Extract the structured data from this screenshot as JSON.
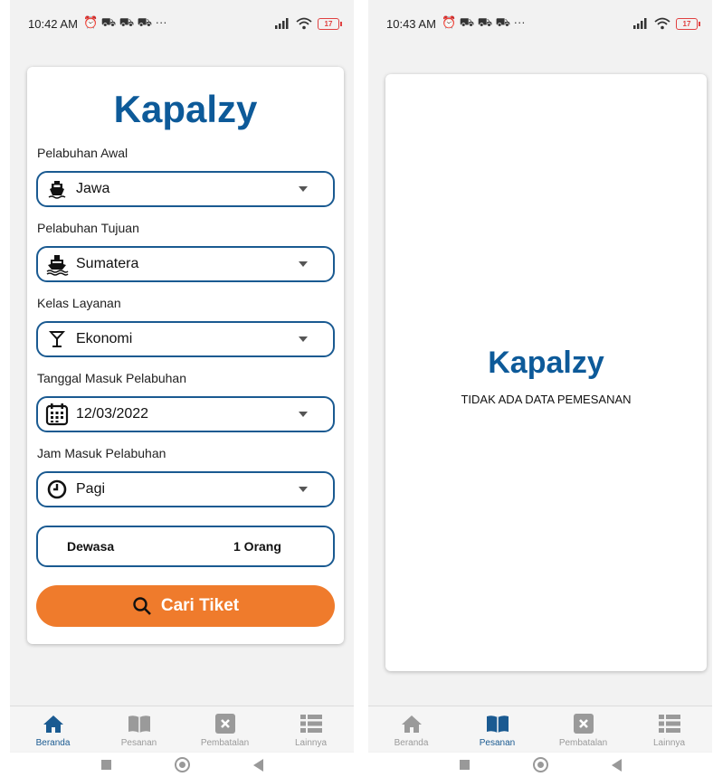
{
  "status_left": {
    "time": "10:42 AM",
    "icons": "⏰ ⛟ ⛟ ⛟ ···",
    "battery": "17"
  },
  "status_right": {
    "time": "10:43 AM",
    "icons": "⏰ ⛟ ⛟ ⛟ ···",
    "battery": "17"
  },
  "search": {
    "brand": "Kapalzy",
    "origin": {
      "label": "Pelabuhan Awal",
      "value": "Jawa",
      "icon": "ship-icon"
    },
    "destination": {
      "label": "Pelabuhan Tujuan",
      "value": "Sumatera",
      "icon": "ship-waves-icon"
    },
    "class": {
      "label": "Kelas Layanan",
      "value": "Ekonomi",
      "icon": "glass-icon"
    },
    "date": {
      "label": "Tanggal Masuk Pelabuhan",
      "value": "12/03/2022",
      "icon": "calendar-icon"
    },
    "time": {
      "label": "Jam Masuk Pelabuhan",
      "value": "Pagi",
      "icon": "clock-icon"
    },
    "passenger": {
      "type": "Dewasa",
      "count": "1 Orang"
    },
    "button_label": "Cari Tiket"
  },
  "orders": {
    "brand": "Kapalzy",
    "empty_message": "TIDAK ADA DATA PEMESANAN"
  },
  "nav": {
    "items": [
      {
        "label": "Beranda",
        "icon": "home-icon"
      },
      {
        "label": "Pesanan",
        "icon": "book-icon"
      },
      {
        "label": "Pembatalan",
        "icon": "cancel-icon"
      },
      {
        "label": "Lainnya",
        "icon": "list-icon"
      }
    ],
    "left_active": "Beranda",
    "right_active": "Pesanan"
  },
  "colors": {
    "brand": "#0d5a99",
    "accent": "#ef7b2c",
    "border": "#1a5a91"
  }
}
